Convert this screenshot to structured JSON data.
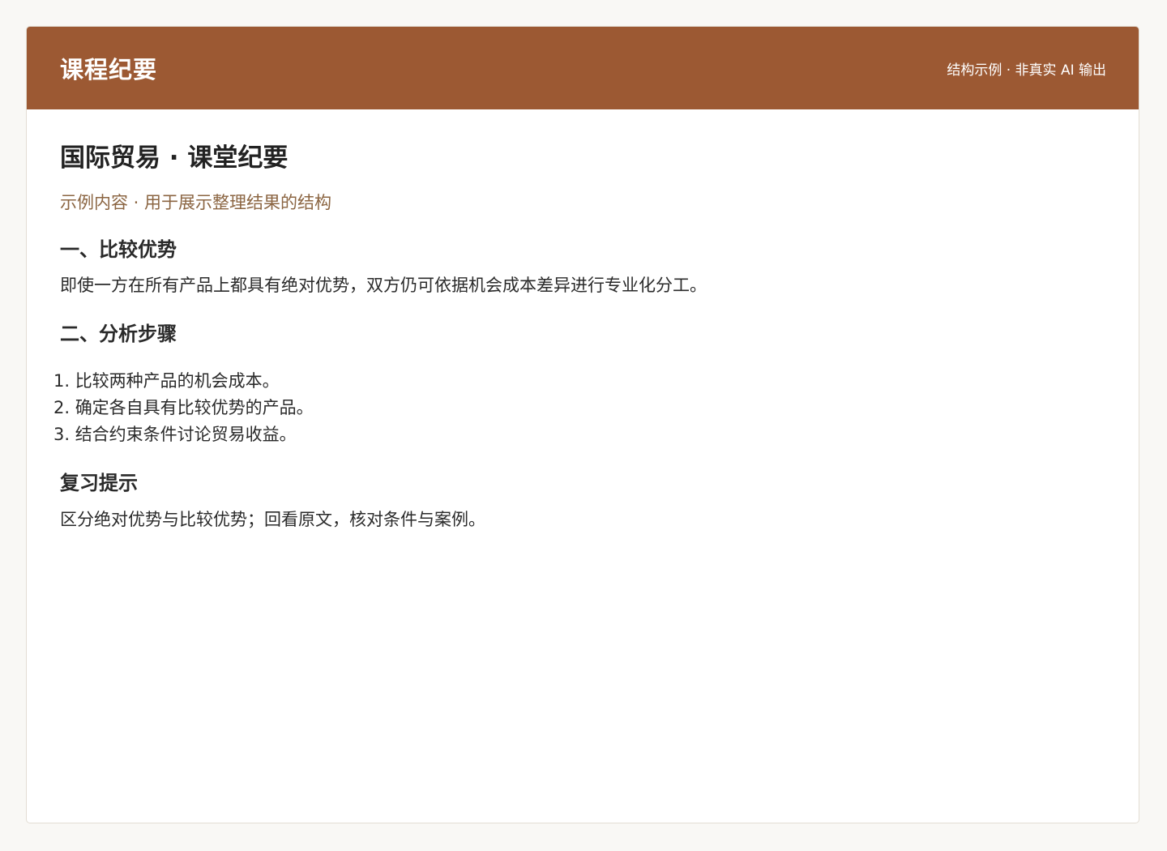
{
  "header": {
    "title": "课程纪要",
    "note": "结构示例 · 非真实 AI 输出"
  },
  "document": {
    "title": "国际贸易 · 课堂纪要",
    "subtitle": "示例内容 · 用于展示整理结果的结构",
    "sections": [
      {
        "heading": "一、比较优势",
        "body": "即使一方在所有产品上都具有绝对优势，双方仍可依据机会成本差异进行专业化分工。"
      },
      {
        "heading": "二、分析步骤",
        "steps": [
          {
            "num": "1.",
            "text": "比较两种产品的机会成本。"
          },
          {
            "num": "2.",
            "text": "确定各自具有比较优势的产品。"
          },
          {
            "num": "3.",
            "text": "结合约束条件讨论贸易收益。"
          }
        ]
      },
      {
        "heading": "复习提示",
        "body": "区分绝对优势与比较优势；回看原文，核对条件与案例。"
      }
    ]
  },
  "colors": {
    "header_bg": "#9c5933",
    "subtitle": "#8b6542",
    "page_bg": "#f9f8f5"
  }
}
